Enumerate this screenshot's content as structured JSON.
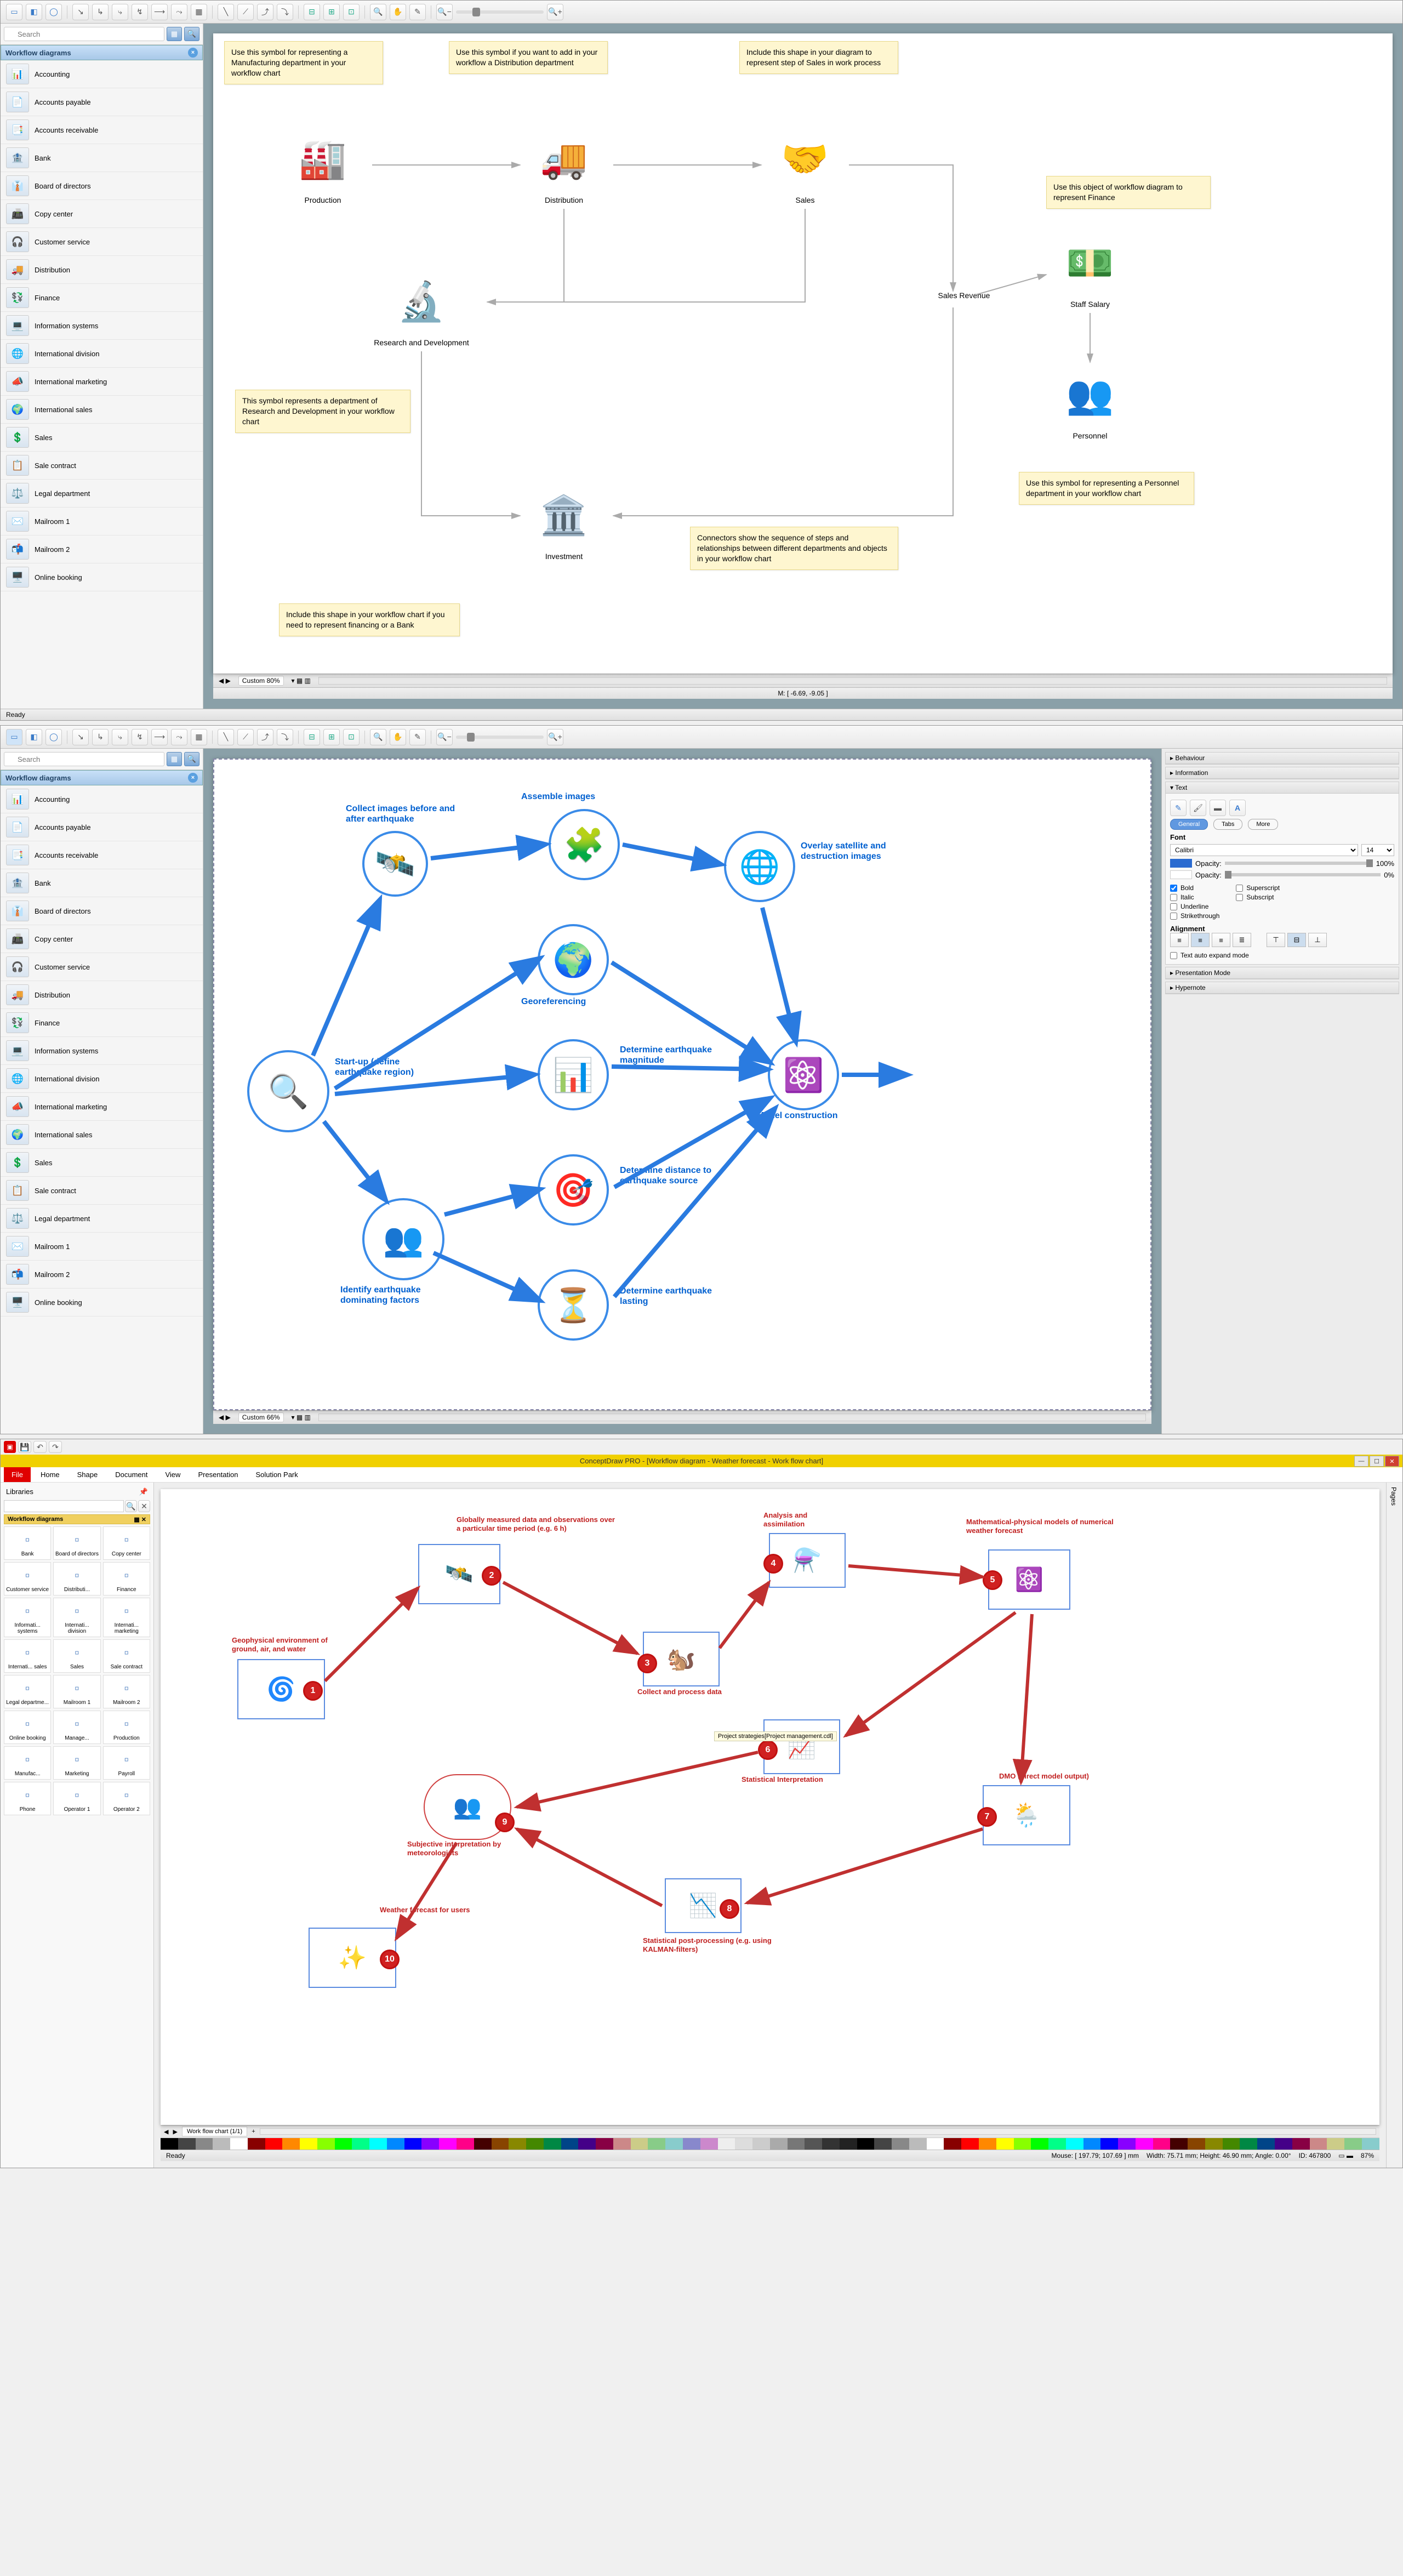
{
  "panel1": {
    "search_placeholder": "Search",
    "lib_title": "Workflow diagrams",
    "lib_items": [
      "Accounting",
      "Accounts payable",
      "Accounts receivable",
      "Bank",
      "Board of directors",
      "Copy center",
      "Customer service",
      "Distribution",
      "Finance",
      "Information systems",
      "International division",
      "International marketing",
      "International sales",
      "Sales",
      "Sale contract",
      "Legal department",
      "Mailroom 1",
      "Mailroom 2",
      "Online booking"
    ],
    "notes": {
      "mfg": "Use this symbol for representing a Manufacturing department in your workflow chart",
      "dist": "Use this symbol if you want to add in your workflow a Distribution department",
      "sales": "Include this shape in your diagram to represent step of Sales in work process",
      "fin": "Use this object of workflow diagram to represent Finance",
      "rnd": "This symbol represents a department of Research and Development in your workflow chart",
      "pers": "Use this symbol for representing a Personnel department in your workflow chart",
      "conn": "Connectors show the sequence of steps and relationships between different departments and objects in your workflow chart",
      "bank": "Include this shape in your workflow chart if you need to represent financing or a Bank"
    },
    "nodes": {
      "production": "Production",
      "distribution": "Distribution",
      "sales": "Sales",
      "staff_salary": "Staff Salary",
      "sales_revenue": "Sales Revenue",
      "personnel": "Personnel",
      "rnd": "Research and Development",
      "investment": "Investment"
    },
    "zoom": "Custom 80%",
    "mouse": "M: [ -6.69, -9.05 ]",
    "ready": "Ready"
  },
  "panel2": {
    "lib_title": "Workflow diagrams",
    "labels": {
      "start": "Start-up (define earthquake region)",
      "collect": "Collect images before and after earthquake",
      "assemble": "Assemble images",
      "overlay": "Overlay satellite and destruction images",
      "georef": "Georeferencing",
      "magnitude": "Determine earthquake magnitude",
      "model": "Model construction",
      "distance": "Determine distance to earthquake source",
      "lasting": "Determine earthquake lasting",
      "identify": "Identify earthquake dominating factors"
    },
    "rpanel": {
      "behaviour": "Behaviour",
      "information": "Information",
      "text": "Text",
      "tab_general": "General",
      "tab_tabs": "Tabs",
      "tab_more": "More",
      "font_label": "Font",
      "font_family": "Calibri",
      "font_size": "14",
      "opacity": "Opacity:",
      "opacity_line": "100%",
      "opacity_text": "0%",
      "bold": "Bold",
      "italic": "Italic",
      "underline": "Underline",
      "strike": "Strikethrough",
      "sup": "Superscript",
      "sub": "Subscript",
      "alignment": "Alignment",
      "autoexpand": "Text auto expand mode",
      "presentation": "Presentation Mode",
      "hypernote": "Hypernote"
    },
    "zoom": "Custom 66%"
  },
  "panel3": {
    "title": "ConceptDraw PRO - [Workflow diagram - Weather forecast - Work flow chart]",
    "menu": [
      "File",
      "Home",
      "Shape",
      "Document",
      "View",
      "Presentation",
      "Solution Park"
    ],
    "lib_title": "Libraries",
    "lib_cat": "Workflow diagrams",
    "grid_items": [
      "Bank",
      "Board of directors",
      "Copy center",
      "Customer service",
      "Distributi...",
      "Finance",
      "Informati... systems",
      "Internati... division",
      "Internati... marketing",
      "Internati... sales",
      "Sales",
      "Sale contract",
      "Legal departme...",
      "Mailroom 1",
      "Mailroom 2",
      "Online booking",
      "Manage...",
      "Production",
      "Manufac...",
      "Marketing",
      "Payroll",
      "Phone",
      "Operator 1",
      "Operator 2"
    ],
    "nodes": {
      "n1": "Geophysical environment of ground, air, and water",
      "n2": "Globally measured data and observations over a particular time period (e.g. 6 h)",
      "n3": "Collect and process data",
      "n4": "Analysis and assimilation",
      "n5": "Mathematical-physical models of numerical weather forecast",
      "n6": "Statistical Interpretation",
      "n7": "DMO (direct model output)",
      "n8": "Statistical post-processing (e.g. using KALMAN-filters)",
      "n9": "Subjective interpretation by meteorologists",
      "n10": "Weather forecast for users",
      "tooltip": "Project strategies[Project management.cdl]"
    },
    "tab": "Work flow chart (1/1)",
    "status": {
      "mouse": "Mouse: [ 197.79; 107.69 ] mm",
      "size": "Width: 75.71 mm; Height: 46.90 mm; Angle: 0.00°",
      "id": "ID: 467800",
      "zoom": "87%",
      "ready": "Ready"
    },
    "pages": "Pages"
  }
}
